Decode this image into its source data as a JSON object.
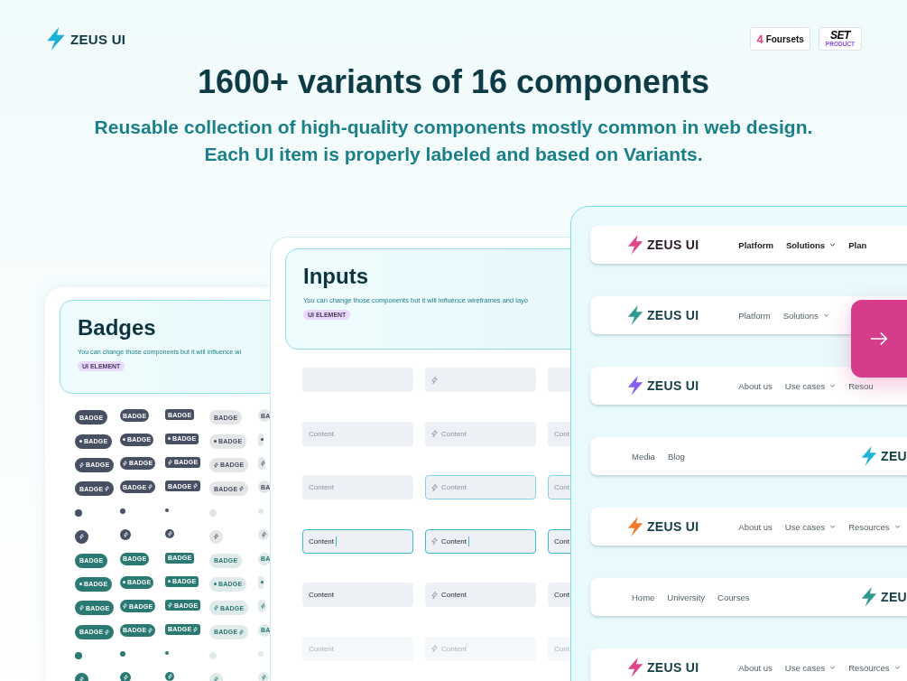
{
  "brand": {
    "logo_text": "ZEUS UI"
  },
  "partners": [
    {
      "mark": "4",
      "name": "Foursets",
      "kind": "foursets"
    },
    {
      "mark": "SET",
      "name": "PRODUCT",
      "kind": "setproduct"
    }
  ],
  "headline": "1600+ variants of 16 components",
  "subtitle_lines": [
    "Reusable collection of high-quality components mostly common in web design.",
    "Each UI item is properly labeled and based on Variants."
  ],
  "badges_panel": {
    "title": "Badges",
    "description": "You can change those components but it will influence wi",
    "tag": "UI ELEMENT",
    "rows": [
      {
        "kind": "text",
        "color": "#474f62",
        "cells": [
          {
            "label": "BADGE"
          },
          {
            "label": "BADGE"
          },
          {
            "label": "BADGE"
          },
          {
            "label": "BADGE"
          },
          {
            "label": "BA"
          }
        ]
      },
      {
        "kind": "dot-text",
        "color": "#474f62",
        "cells": [
          {
            "label": "BADGE"
          },
          {
            "label": "BADGE"
          },
          {
            "label": "BADGE"
          },
          {
            "label": "BADGE"
          },
          {}
        ]
      },
      {
        "kind": "icon-text",
        "color": "#474f62",
        "cells": [
          {
            "label": "BADGE"
          },
          {
            "label": "BADGE"
          },
          {
            "label": "BADGE"
          },
          {
            "label": "BADGE"
          },
          {}
        ]
      },
      {
        "kind": "text-icon",
        "color": "#474f62",
        "cells": [
          {
            "label": "BADGE"
          },
          {
            "label": "BADGE"
          },
          {
            "label": "BADGE"
          },
          {
            "label": "BADGE"
          },
          {
            "label": "BA"
          }
        ]
      },
      {
        "kind": "dot",
        "color": "#474f62",
        "cells": [
          {},
          {},
          {},
          {},
          {}
        ]
      },
      {
        "kind": "icon",
        "color": "#474f62",
        "cells": [
          {},
          {},
          {},
          {},
          {}
        ]
      },
      {
        "kind": "text",
        "color": "#2a7a73",
        "cells": [
          {
            "label": "BADGE"
          },
          {
            "label": "BADGE"
          },
          {
            "label": "BADGE"
          },
          {
            "label": "BADGE"
          },
          {
            "label": "BA"
          }
        ]
      },
      {
        "kind": "dot-text",
        "color": "#2a7a73",
        "cells": [
          {
            "label": "BADGE"
          },
          {
            "label": "BADGE"
          },
          {
            "label": "BADGE"
          },
          {
            "label": "BADGE"
          },
          {}
        ]
      },
      {
        "kind": "icon-text",
        "color": "#2a7a73",
        "cells": [
          {
            "label": "BADGE"
          },
          {
            "label": "BADGE"
          },
          {
            "label": "BADGE"
          },
          {
            "label": "BADGE"
          },
          {}
        ]
      },
      {
        "kind": "text-icon",
        "color": "#2a7a73",
        "cells": [
          {
            "label": "BADGE"
          },
          {
            "label": "BADGE"
          },
          {
            "label": "BADGE"
          },
          {
            "label": "BADGE"
          },
          {
            "label": "BA"
          }
        ]
      },
      {
        "kind": "dot",
        "color": "#2a7a73",
        "cells": [
          {},
          {},
          {},
          {},
          {}
        ]
      },
      {
        "kind": "icon",
        "color": "#2a7a73",
        "cells": [
          {},
          {},
          {},
          {},
          {}
        ]
      }
    ]
  },
  "inputs_panel": {
    "title": "Inputs",
    "description": "You can change those components but it will influence wireframes and layo",
    "tag": "UI ELEMENT",
    "rows": [
      {
        "kind": "empty",
        "fields": [
          {
            "icon": false
          },
          {
            "icon": true
          },
          {
            "icon": false
          }
        ]
      },
      {
        "kind": "placeholder",
        "fields": [
          {
            "icon": false,
            "placeholder": "Content"
          },
          {
            "icon": true,
            "placeholder": "Content"
          },
          {
            "icon": false,
            "placeholder": "Cont"
          }
        ]
      },
      {
        "kind": "hover",
        "fields": [
          {
            "icon": false,
            "placeholder": "Content"
          },
          {
            "icon": true,
            "placeholder": "Content"
          },
          {
            "icon": false,
            "placeholder": "Cont"
          }
        ]
      },
      {
        "kind": "focused",
        "fields": [
          {
            "icon": false,
            "value": "Content",
            "caret": true
          },
          {
            "icon": true,
            "value": "Content",
            "caret": true
          },
          {
            "icon": false,
            "value": "Cont"
          }
        ]
      },
      {
        "kind": "filled",
        "fields": [
          {
            "icon": false,
            "value": "Content"
          },
          {
            "icon": true,
            "value": "Content"
          },
          {
            "icon": false,
            "value": "Cont"
          }
        ]
      },
      {
        "kind": "disabled",
        "fields": [
          {
            "icon": false,
            "placeholder": "Content"
          },
          {
            "icon": true,
            "placeholder": "Content"
          },
          {
            "icon": false,
            "placeholder": "Cont"
          }
        ]
      }
    ]
  },
  "navbars": [
    {
      "kind": "logo-left-bold",
      "color": "#e0468a",
      "logo_text": "ZEUS UI",
      "items": [
        {
          "label": "Platform",
          "caret": false
        },
        {
          "label": "Solutions",
          "caret": true
        },
        {
          "label": "Plan",
          "caret": false
        }
      ]
    },
    {
      "kind": "logo-left",
      "color": "#2f9a8f",
      "logo_text": "ZEUS UI",
      "items": [
        {
          "label": "Platform",
          "caret": false
        },
        {
          "label": "Solutions",
          "caret": true
        }
      ]
    },
    {
      "kind": "logo-left",
      "color": "#8a5cf0",
      "logo_text": "ZEUS UI",
      "items": [
        {
          "label": "About us",
          "caret": false
        },
        {
          "label": "Use cases",
          "caret": true
        },
        {
          "label": "Resou",
          "caret": false
        }
      ]
    },
    {
      "kind": "logo-right",
      "color": "#1fb5d6",
      "logo_text": "ZEU",
      "items": [
        {
          "label": "Media",
          "caret": false
        },
        {
          "label": "Blog",
          "caret": false
        }
      ]
    },
    {
      "kind": "logo-left",
      "color": "#ee7a2a",
      "logo_text": "ZEUS UI",
      "items": [
        {
          "label": "About us",
          "caret": false
        },
        {
          "label": "Use cases",
          "caret": true
        },
        {
          "label": "Resources",
          "caret": true
        }
      ]
    },
    {
      "kind": "logo-right",
      "color": "#2f9a8f",
      "logo_text": "ZEU",
      "items": [
        {
          "label": "Home",
          "caret": false
        },
        {
          "label": "University",
          "caret": false
        },
        {
          "label": "Courses",
          "caret": false
        }
      ]
    },
    {
      "kind": "logo-left",
      "color": "#e0468a",
      "logo_text": "ZEUS UI",
      "items": [
        {
          "label": "About us",
          "caret": false
        },
        {
          "label": "Use cases",
          "caret": true
        },
        {
          "label": "Resources",
          "caret": true
        }
      ]
    }
  ]
}
